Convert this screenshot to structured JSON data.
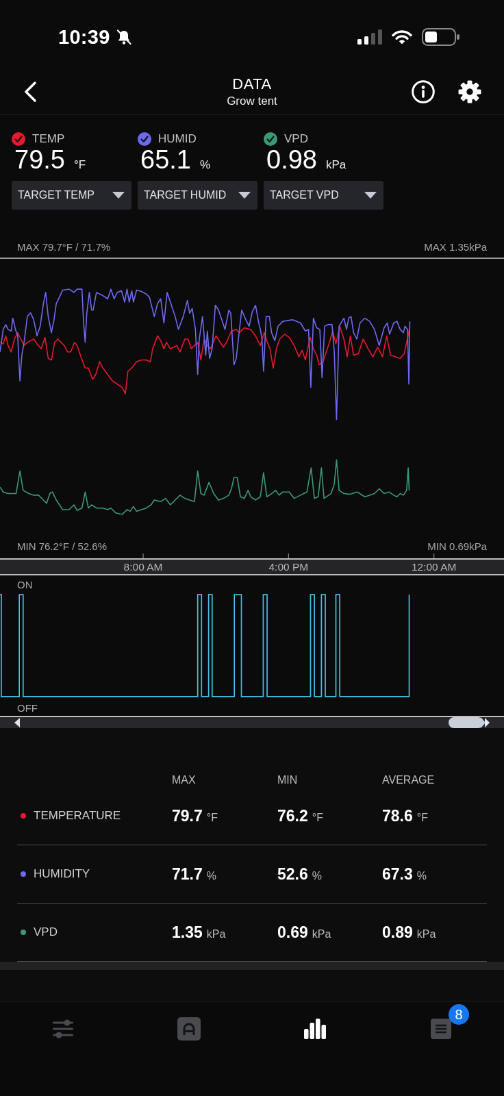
{
  "status_bar": {
    "time": "10:39"
  },
  "header": {
    "title": "DATA",
    "subtitle": "Grow tent"
  },
  "sensors": [
    {
      "label": "TEMP",
      "value": "79.5",
      "unit": "°F",
      "checked": true,
      "color": "#e8192c",
      "target": "TARGET TEMP"
    },
    {
      "label": "HUMID",
      "value": "65.1",
      "unit": "%",
      "checked": true,
      "color": "#6d6af2",
      "target": "TARGET HUMID"
    },
    {
      "label": "VPD",
      "value": "0.98",
      "unit": "kPa",
      "checked": true,
      "color": "#3a9a74",
      "target": "TARGET VPD"
    }
  ],
  "chart": {
    "max_left": "MAX 79.7°F / 71.7%",
    "max_right": "MAX 1.35kPa",
    "min_left": "MIN 76.2°F / 52.6%",
    "min_right": "MIN 0.69kPa",
    "time_labels": [
      "8:00 AM",
      "4:00 PM",
      "12:00 AM"
    ]
  },
  "switch_chart": {
    "on_label": "ON",
    "off_label": "OFF"
  },
  "stats": {
    "columns": [
      "MAX",
      "MIN",
      "AVERAGE"
    ],
    "rows": [
      {
        "name": "TEMPERATURE",
        "color": "#e8192c",
        "cells": [
          {
            "value": "79.7",
            "unit": "°F"
          },
          {
            "value": "76.2",
            "unit": "°F"
          },
          {
            "value": "78.6",
            "unit": "°F"
          }
        ]
      },
      {
        "name": "HUMIDITY",
        "color": "#6d6af2",
        "cells": [
          {
            "value": "71.7",
            "unit": "%"
          },
          {
            "value": "52.6",
            "unit": "%"
          },
          {
            "value": "67.3",
            "unit": "%"
          }
        ]
      },
      {
        "name": "VPD",
        "color": "#3a9a74",
        "cells": [
          {
            "value": "1.35",
            "unit": "kPa"
          },
          {
            "value": "0.69",
            "unit": "kPa"
          },
          {
            "value": "0.89",
            "unit": "kPa"
          }
        ]
      }
    ]
  },
  "tab_bar": {
    "tabs": [
      {
        "kind": "sliders",
        "selected": false
      },
      {
        "kind": "device",
        "selected": false
      },
      {
        "kind": "chart",
        "selected": true
      },
      {
        "kind": "log",
        "selected": false,
        "badge": "8"
      }
    ]
  }
}
